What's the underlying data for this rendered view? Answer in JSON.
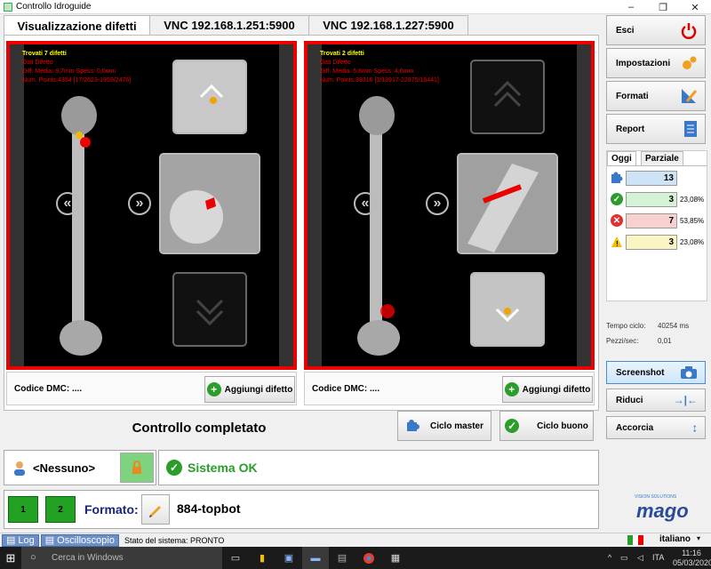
{
  "window": {
    "title": "Controllo Idroguide",
    "controls": [
      "–",
      "❐",
      "✕"
    ]
  },
  "tabs": [
    {
      "label": "Visualizzazione difetti",
      "active": true
    },
    {
      "label": "VNC 192.168.1.251:5900",
      "active": false
    },
    {
      "label": "VNC 192.168.1.227:5900",
      "active": false
    }
  ],
  "panes": [
    {
      "info": {
        "found": "Trovati 7 difetti",
        "name": "Dati Difetto",
        "diff": "Diff. Media: 9,7mm Spess: 0,0mm",
        "points": "Num. Points:4354 [17/2623-1959/2476]"
      },
      "dmc_label": "Codice DMC: ....",
      "add_button": "Aggiungi difetto"
    },
    {
      "info": {
        "found": "Trovati 2 difetti",
        "name": "Dati Difetto",
        "diff": "Diff. Media: 5,8mm Spess: 4,6mm",
        "points": "Num. Points:39316 [3/18917-22875/18441]"
      },
      "dmc_label": "Codice DMC: ....",
      "add_button": "Aggiungi difetto"
    }
  ],
  "status": {
    "completed": "Controllo completato",
    "ciclo_master": "Ciclo master",
    "ciclo_buono": "Ciclo buono",
    "user": "<Nessuno>",
    "system": "Sistema OK",
    "format_label": "Formato:",
    "format_value": "884-topbot",
    "format_buttons": [
      "1",
      "2"
    ]
  },
  "bottombar": {
    "log": "Log",
    "osc": "Oscilloscopio",
    "state": "Stato del sistema: PRONTO",
    "language": "italiano"
  },
  "right": {
    "buttons": {
      "exit": "Esci",
      "settings": "Impostazioni",
      "formats": "Formati",
      "report": "Report",
      "screenshot": "Screenshot",
      "reduce": "Riduci",
      "shorten": "Accorcia"
    },
    "stat_tabs": [
      "Oggi",
      "Parziale"
    ],
    "stats": [
      {
        "kind": "total",
        "value": "13",
        "pct": ""
      },
      {
        "kind": "ok",
        "value": "3",
        "pct": "23,08%"
      },
      {
        "kind": "ko",
        "value": "7",
        "pct": "53,85%"
      },
      {
        "kind": "warn",
        "value": "3",
        "pct": "23,08%"
      }
    ],
    "tempo_ciclo_label": "Tempo ciclo:",
    "tempo_ciclo": "40254 ms",
    "pezzi_label": "Pezzi/sec:",
    "pezzi": "0,01",
    "brand": {
      "top": "VISION SOLUTIONS",
      "name": "mago"
    }
  },
  "taskbar": {
    "search": "Cerca in Windows",
    "lang": "ITA",
    "time": "11:16",
    "date": "05/03/2020"
  },
  "colors": {
    "alarm": "#e00000",
    "ok": "#2a9d2a",
    "accent": "#6d8fc8"
  }
}
